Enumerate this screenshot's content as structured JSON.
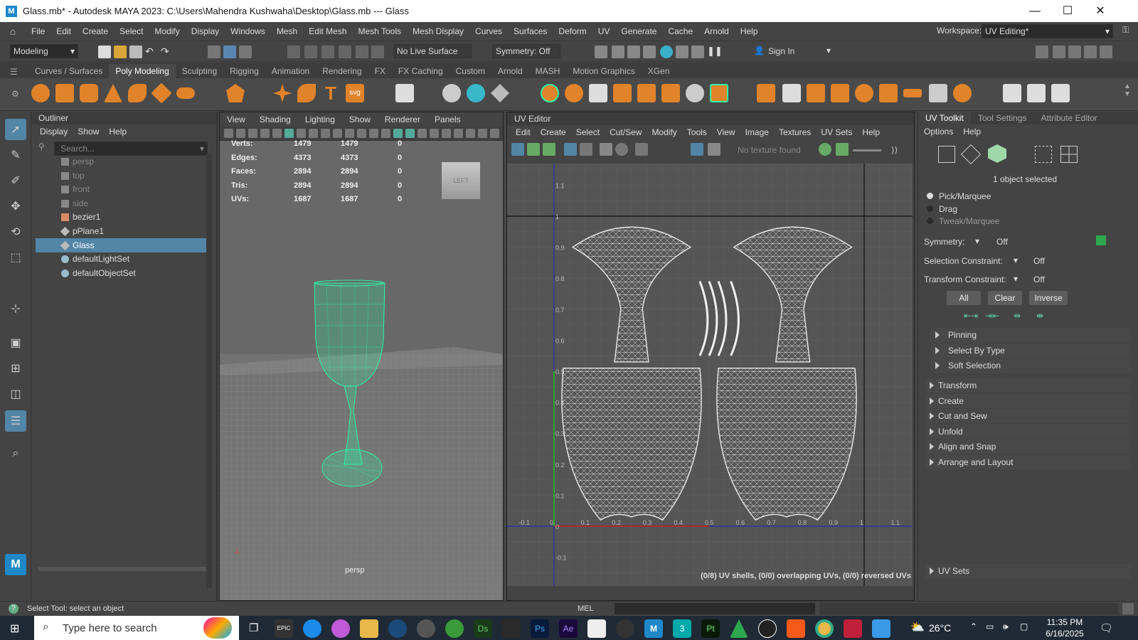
{
  "window": {
    "title": "Glass.mb* - Autodesk MAYA 2023: C:\\Users\\Mahendra Kushwaha\\Desktop\\Glass.mb   ---   Glass",
    "minimize": "—",
    "maximize": "☐",
    "close": "✕"
  },
  "menu": [
    "File",
    "Edit",
    "Create",
    "Select",
    "Modify",
    "Display",
    "Windows",
    "Mesh",
    "Edit Mesh",
    "Mesh Tools",
    "Mesh Display",
    "Curves",
    "Surfaces",
    "Deform",
    "UV",
    "Generate",
    "Cache",
    "Arnold",
    "Help"
  ],
  "workspace": {
    "label": "Workspace:",
    "value": "UV Editing*"
  },
  "status": {
    "mode": "Modeling",
    "live_surface": "No Live Surface",
    "symmetry": "Symmetry: Off",
    "sign_in": "Sign In"
  },
  "shelf_tabs": [
    "Curves / Surfaces",
    "Poly Modeling",
    "Sculpting",
    "Rigging",
    "Animation",
    "Rendering",
    "FX",
    "FX Caching",
    "Custom",
    "Arnold",
    "MASH",
    "Motion Graphics",
    "XGen"
  ],
  "shelf_active": "Poly Modeling",
  "outliner": {
    "title": "Outliner",
    "menu": [
      "Display",
      "Show",
      "Help"
    ],
    "search_placeholder": "Search...",
    "items": [
      {
        "label": "persp",
        "icon": "camera-icon",
        "dim": true
      },
      {
        "label": "top",
        "icon": "camera-icon",
        "dim": true
      },
      {
        "label": "front",
        "icon": "camera-icon",
        "dim": true
      },
      {
        "label": "side",
        "icon": "camera-icon",
        "dim": true
      },
      {
        "label": "bezier1",
        "icon": "curve-icon",
        "dim": false
      },
      {
        "label": "pPlane1",
        "icon": "mesh-icon",
        "dim": false
      },
      {
        "label": "Glass",
        "icon": "mesh-icon",
        "dim": false,
        "selected": true
      },
      {
        "label": "defaultLightSet",
        "icon": "set-icon",
        "dim": false
      },
      {
        "label": "defaultObjectSet",
        "icon": "set-icon",
        "dim": false
      }
    ]
  },
  "viewport": {
    "menu": [
      "View",
      "Shading",
      "Lighting",
      "Show",
      "Renderer",
      "Panels"
    ],
    "hud": [
      {
        "label": "Verts:",
        "a": "1479",
        "b": "1479",
        "c": "0"
      },
      {
        "label": "Edges:",
        "a": "4373",
        "b": "4373",
        "c": "0"
      },
      {
        "label": "Faces:",
        "a": "2894",
        "b": "2894",
        "c": "0"
      },
      {
        "label": "Tris:",
        "a": "2894",
        "b": "2894",
        "c": "0"
      },
      {
        "label": "UVs:",
        "a": "1687",
        "b": "1687",
        "c": "0"
      }
    ],
    "view_cube": "LEFT",
    "camera": "persp"
  },
  "uv_editor": {
    "title": "UV Editor",
    "menu": [
      "Edit",
      "Create",
      "Select",
      "Cut/Sew",
      "Modify",
      "Tools",
      "View",
      "Image",
      "Textures",
      "UV Sets",
      "Help"
    ],
    "texture": "No texture found",
    "y_ticks": [
      "1.1",
      "1",
      "0.9",
      "0.8",
      "0.7",
      "0.6",
      "0.5",
      "0.4",
      "0.3",
      "0.2",
      "0.1",
      "0",
      "-0.1"
    ],
    "x_ticks": [
      "-0.1",
      "0",
      "0.1",
      "0.2",
      "0.3",
      "0.4",
      "0.5",
      "0.6",
      "0.7",
      "0.8",
      "0.9",
      "1",
      "1.1"
    ],
    "status": "(0/8) UV shells, (0/0) overlapping UVs, (0/0) reversed UVs"
  },
  "uv_toolkit": {
    "tabs": [
      "UV Toolkit",
      "Tool Settings",
      "Attribute Editor"
    ],
    "menu": [
      "Options",
      "Help"
    ],
    "selected_text": "1 object selected",
    "modes": [
      "Pick/Marquee",
      "Drag",
      "Tweak/Marquee"
    ],
    "symmetry": {
      "label": "Symmetry:",
      "value": "Off"
    },
    "selection_constraint": {
      "label": "Selection Constraint:",
      "value": "Off"
    },
    "transform_constraint": {
      "label": "Transform Constraint:",
      "value": "Off"
    },
    "buttons": [
      "All",
      "Clear",
      "Inverse"
    ],
    "sub_sections": [
      "Pinning",
      "Select By Type",
      "Soft Selection"
    ],
    "sections": [
      "Transform",
      "Create",
      "Cut and Sew",
      "Unfold",
      "Align and Snap",
      "Arrange and Layout"
    ],
    "uv_sets": "UV Sets"
  },
  "helpline": {
    "text": "Select Tool: select an object",
    "mel": "MEL"
  },
  "taskbar": {
    "search": "Type here to search",
    "temp": "26°C",
    "time": "11:35 PM",
    "date": "6/16/2025"
  },
  "colors": {
    "wire": "#2ef5a8",
    "selection": "#5285a6",
    "uv_wire": "#e8e8e8"
  }
}
